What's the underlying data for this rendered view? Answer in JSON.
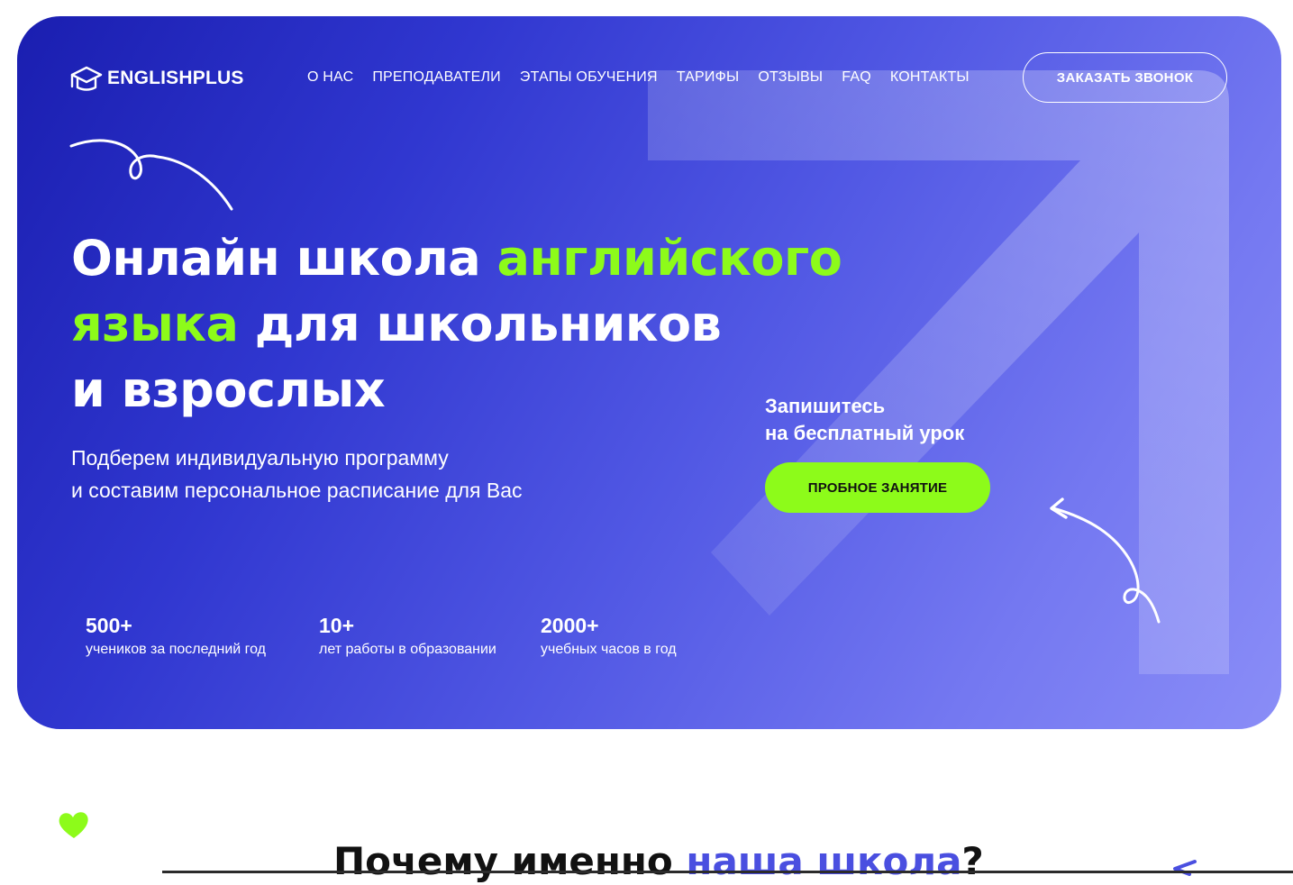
{
  "colors": {
    "accent_green": "#8dfb1a",
    "hero_gradient_start": "#1a1eb0",
    "hero_gradient_end": "#8a8df7",
    "title_accent": "#4a4fe0"
  },
  "header": {
    "logo_icon": "graduation-cap-icon",
    "logo_text": "ENGLISHPLUS",
    "nav": [
      {
        "label": "О НАС"
      },
      {
        "label": "ПРЕПОДАВАТЕЛИ"
      },
      {
        "label": "ЭТАПЫ ОБУЧЕНИЯ"
      },
      {
        "label": "ТАРИФЫ"
      },
      {
        "label": "ОТЗЫВЫ"
      },
      {
        "label": "FAQ"
      },
      {
        "label": "КОНТАКТЫ"
      }
    ],
    "call_button": "ЗАКАЗАТЬ ЗВОНОК"
  },
  "hero": {
    "headline_part1": "Онлайн школа ",
    "headline_accent1": "английского",
    "headline_accent2": "языка",
    "headline_part2": " для школьников",
    "headline_part3": "и взрослых",
    "subtitle_line1": "Подберем индивидуальную программу",
    "subtitle_line2": "и составим персональное расписание для Вас",
    "cta_line1": "Запишитесь",
    "cta_line2": "на бесплатный урок",
    "trial_button": "ПРОБНОЕ ЗАНЯТИЕ"
  },
  "stats": [
    {
      "value": "500+",
      "label": "учеников за последний год"
    },
    {
      "value": "10+",
      "label": "лет работы в образовании"
    },
    {
      "value": "2000+",
      "label": "учебных часов в год"
    }
  ],
  "why": {
    "title_part1": "Почему именно ",
    "title_accent": "наша школа",
    "title_part2": "?"
  }
}
